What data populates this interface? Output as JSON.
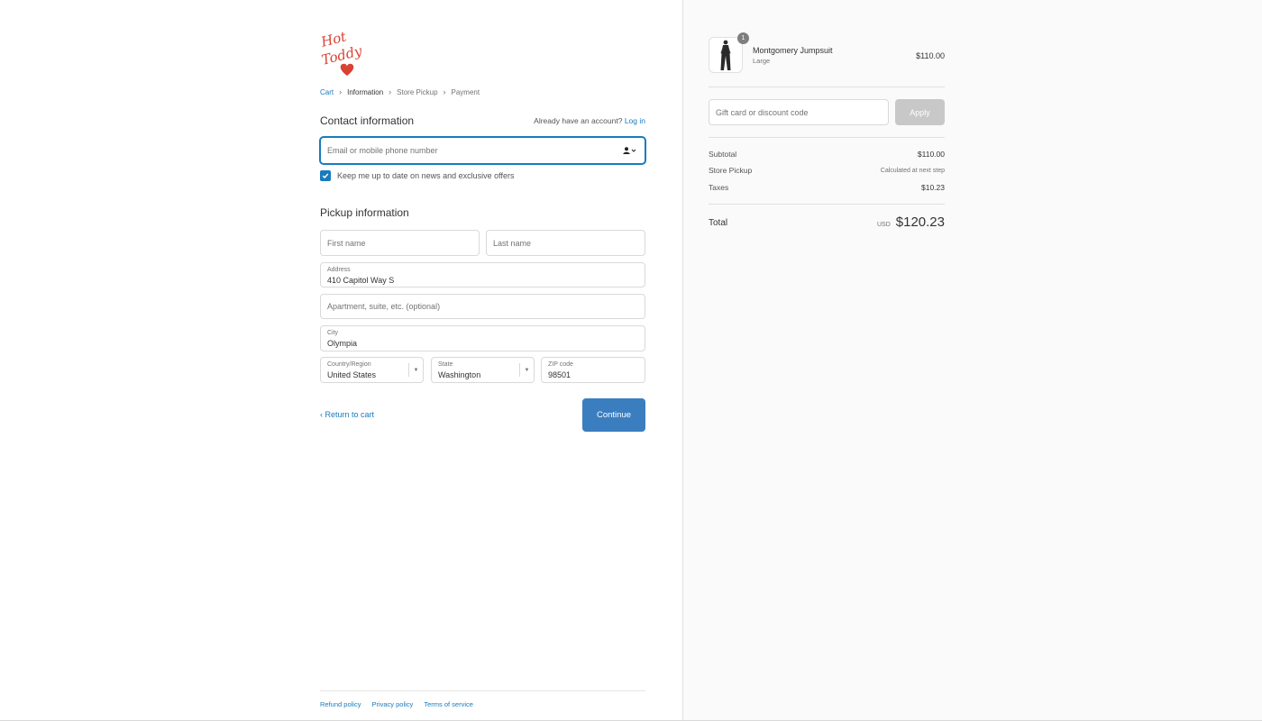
{
  "brand": {
    "logo_text_top": "Hot",
    "logo_text_bottom": "Toddy",
    "color": "#d94132"
  },
  "breadcrumb": [
    {
      "label": "Cart",
      "state": "link"
    },
    {
      "label": "Information",
      "state": "current"
    },
    {
      "label": "Store Pickup",
      "state": "upcoming"
    },
    {
      "label": "Payment",
      "state": "upcoming"
    }
  ],
  "contact": {
    "title": "Contact information",
    "account_prompt": "Already have an account?",
    "login_label": "Log in",
    "email_placeholder": "Email or mobile phone number",
    "newsletter_label": "Keep me up to date on news and exclusive offers",
    "newsletter_checked": true
  },
  "pickup": {
    "title": "Pickup information",
    "first_name_placeholder": "First name",
    "last_name_placeholder": "Last name",
    "address_label": "Address",
    "address_value": "410 Capitol Way S",
    "apartment_placeholder": "Apartment, suite, etc. (optional)",
    "city_label": "City",
    "city_value": "Olympia",
    "country_label": "Country/Region",
    "country_value": "United States",
    "state_label": "State",
    "state_value": "Washington",
    "zip_label": "ZIP code",
    "zip_value": "98501"
  },
  "actions": {
    "return_label": "Return to cart",
    "continue_label": "Continue"
  },
  "footer": {
    "links": [
      "Refund policy",
      "Privacy policy",
      "Terms of service"
    ]
  },
  "summary": {
    "product": {
      "name": "Montgomery Jumpsuit",
      "variant": "Large",
      "price": "$110.00",
      "quantity": "1"
    },
    "discount_placeholder": "Gift card or discount code",
    "apply_label": "Apply",
    "subtotal_label": "Subtotal",
    "subtotal_value": "$110.00",
    "shipping_label": "Store Pickup",
    "shipping_value": "Calculated at next step",
    "taxes_label": "Taxes",
    "taxes_value": "$10.23",
    "total_label": "Total",
    "total_currency": "USD",
    "total_value": "$120.23"
  },
  "colors": {
    "accent": "#197bbd",
    "button": "#3b7ec0",
    "apply_disabled": "#c8c8c8",
    "sidebar_bg": "#fafafa"
  },
  "icons": [
    "heart-icon",
    "chevron-right-icon",
    "contact-person-icon",
    "chevron-down-icon",
    "checkmark-icon",
    "chevron-left-icon"
  ]
}
